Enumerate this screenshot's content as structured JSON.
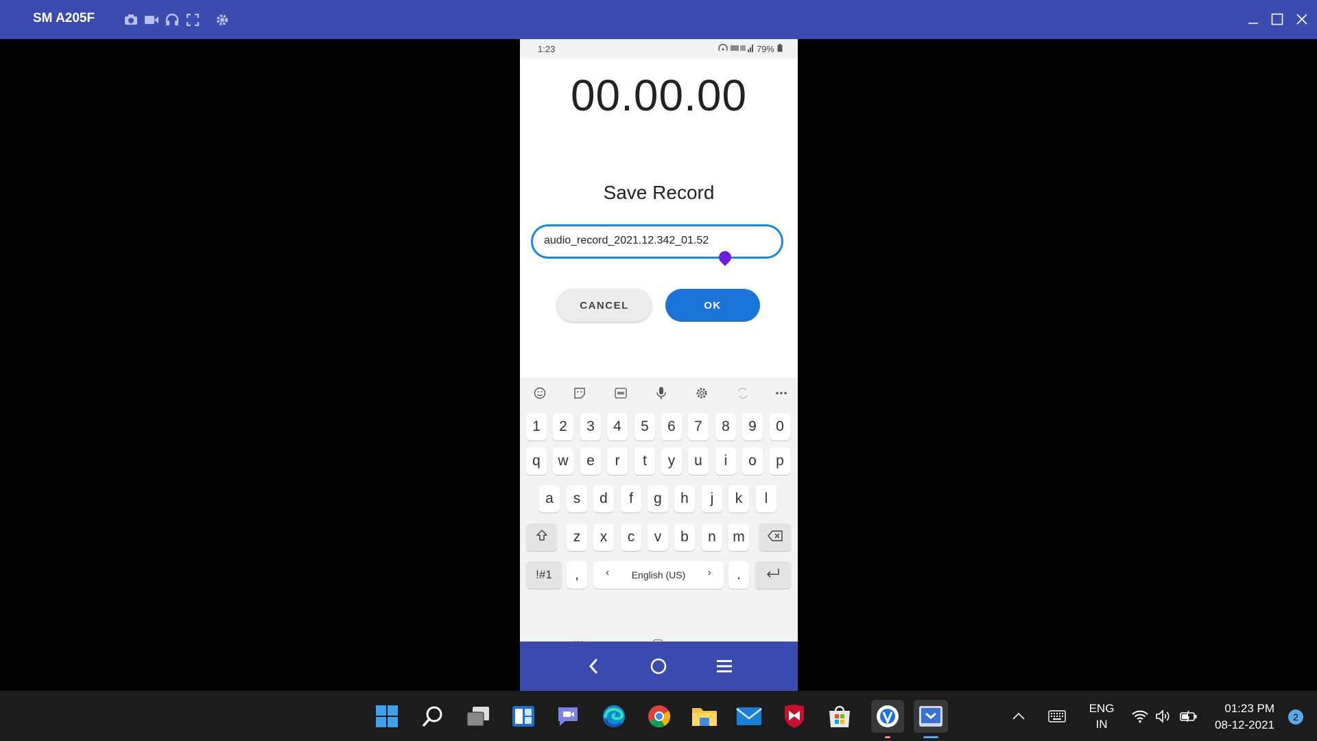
{
  "window": {
    "device_name": "SM A205F"
  },
  "phone": {
    "status": {
      "time": "1:23",
      "battery": "79%"
    },
    "timer": "00.00.00",
    "dialog": {
      "title": "Save Record",
      "filename": "audio_record_2021.12.342_01.52",
      "cancel_label": "CANCEL",
      "ok_label": "OK"
    },
    "keyboard": {
      "number_row": [
        "1",
        "2",
        "3",
        "4",
        "5",
        "6",
        "7",
        "8",
        "9",
        "0"
      ],
      "row1": [
        "q",
        "w",
        "e",
        "r",
        "t",
        "y",
        "u",
        "i",
        "o",
        "p"
      ],
      "row2": [
        "a",
        "s",
        "d",
        "f",
        "g",
        "h",
        "j",
        "k",
        "l"
      ],
      "row3": [
        "z",
        "x",
        "c",
        "v",
        "b",
        "n",
        "m"
      ],
      "symbols_label": "!#1",
      "comma": ",",
      "language": "English (US)",
      "period": "."
    }
  },
  "taskbar": {
    "language_line1": "ENG",
    "language_line2": "IN",
    "time": "01:23 PM",
    "date": "08-12-2021",
    "notification_count": "2"
  },
  "colors": {
    "title_bar": "#3b4bb0",
    "accent": "#1a73d8",
    "cursor_handle": "#6a1de0"
  }
}
